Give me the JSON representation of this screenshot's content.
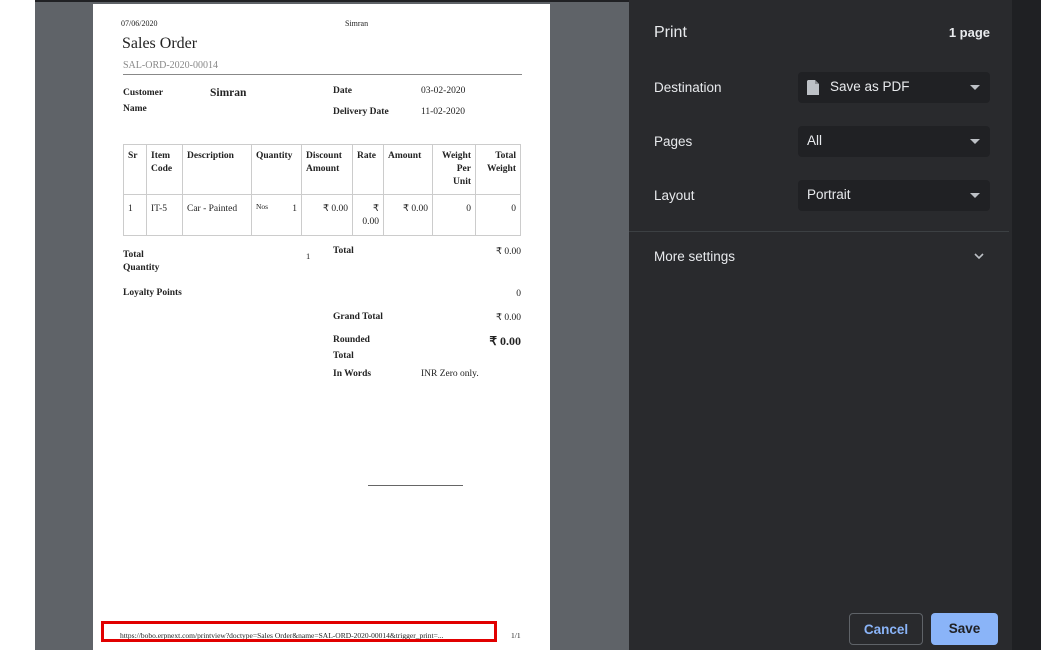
{
  "print_dialog": {
    "title": "Print",
    "page_count": "1 page",
    "destination": {
      "label": "Destination",
      "value": "Save as PDF"
    },
    "pages": {
      "label": "Pages",
      "value": "All"
    },
    "layout": {
      "label": "Layout",
      "value": "Portrait"
    },
    "more_settings": "More settings",
    "cancel": "Cancel",
    "save": "Save"
  },
  "document": {
    "header_date": "07/06/2020",
    "header_user": "Simran",
    "title": "Sales Order",
    "doc_number": "SAL-ORD-2020-00014",
    "customer_label_1": "Customer",
    "customer_label_2": "Name",
    "customer_value": "Simran",
    "date_label": "Date",
    "date_value": "03-02-2020",
    "delivery_label": "Delivery Date",
    "delivery_value": "11-02-2020",
    "table": {
      "headers": [
        [
          "Sr"
        ],
        [
          "Item",
          "Code"
        ],
        [
          "Description"
        ],
        [
          "Quantity"
        ],
        [
          "Discount",
          "Amount"
        ],
        [
          "Rate"
        ],
        [
          "Amount"
        ],
        [
          "Weight",
          "Per",
          "Unit"
        ],
        [
          "Total",
          "Weight"
        ]
      ],
      "row": {
        "sr": "1",
        "item_code": "IT-5",
        "description": "Car - Painted",
        "uom": "Nos",
        "qty": "1",
        "discount": "₹ 0.00",
        "rate_1": "₹",
        "rate_2": "0.00",
        "amount": "₹ 0.00",
        "weight_per_unit": "0",
        "total_weight": "0"
      }
    },
    "total_qty_label_1": "Total",
    "total_qty_label_2": "Quantity",
    "total_qty_value": "1",
    "total_label": "Total",
    "total_value": "₹ 0.00",
    "loyalty_label": "Loyalty Points",
    "loyalty_value": "0",
    "grand_total_label": "Grand Total",
    "grand_total_value": "₹ 0.00",
    "rounded_label_1": "Rounded",
    "rounded_label_2": "Total",
    "rounded_value": "₹ 0.00",
    "in_words_label": "In Words",
    "in_words_value": "INR Zero only.",
    "footer_url": "https://bobo.erpnext.com/printview?doctype=Sales Order&name=SAL-ORD-2020-00014&trigger_print=...",
    "footer_page": "1/1"
  }
}
